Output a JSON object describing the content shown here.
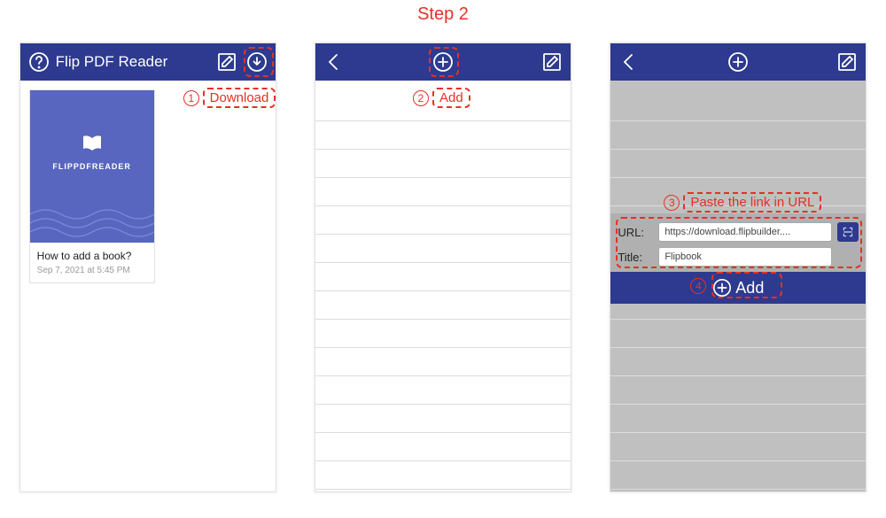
{
  "step_title": "Step 2",
  "annotations": {
    "a1": {
      "num": "1",
      "text": "Download"
    },
    "a2": {
      "num": "2",
      "text": "Add"
    },
    "a3": {
      "num": "3",
      "text": "Paste the link in URL"
    },
    "a4": {
      "num": "4"
    }
  },
  "phone1": {
    "title": "Flip PDF Reader",
    "book": {
      "brand": "FLIPPDFREADER",
      "title": "How to add a book?",
      "date": "Sep 7, 2021 at 5:45 PM"
    }
  },
  "phone3": {
    "form": {
      "url_label": "URL:",
      "url_value": "https://download.flipbuilder....",
      "title_label": "Title:",
      "title_value": "Flipbook",
      "add_label": "Add"
    }
  }
}
